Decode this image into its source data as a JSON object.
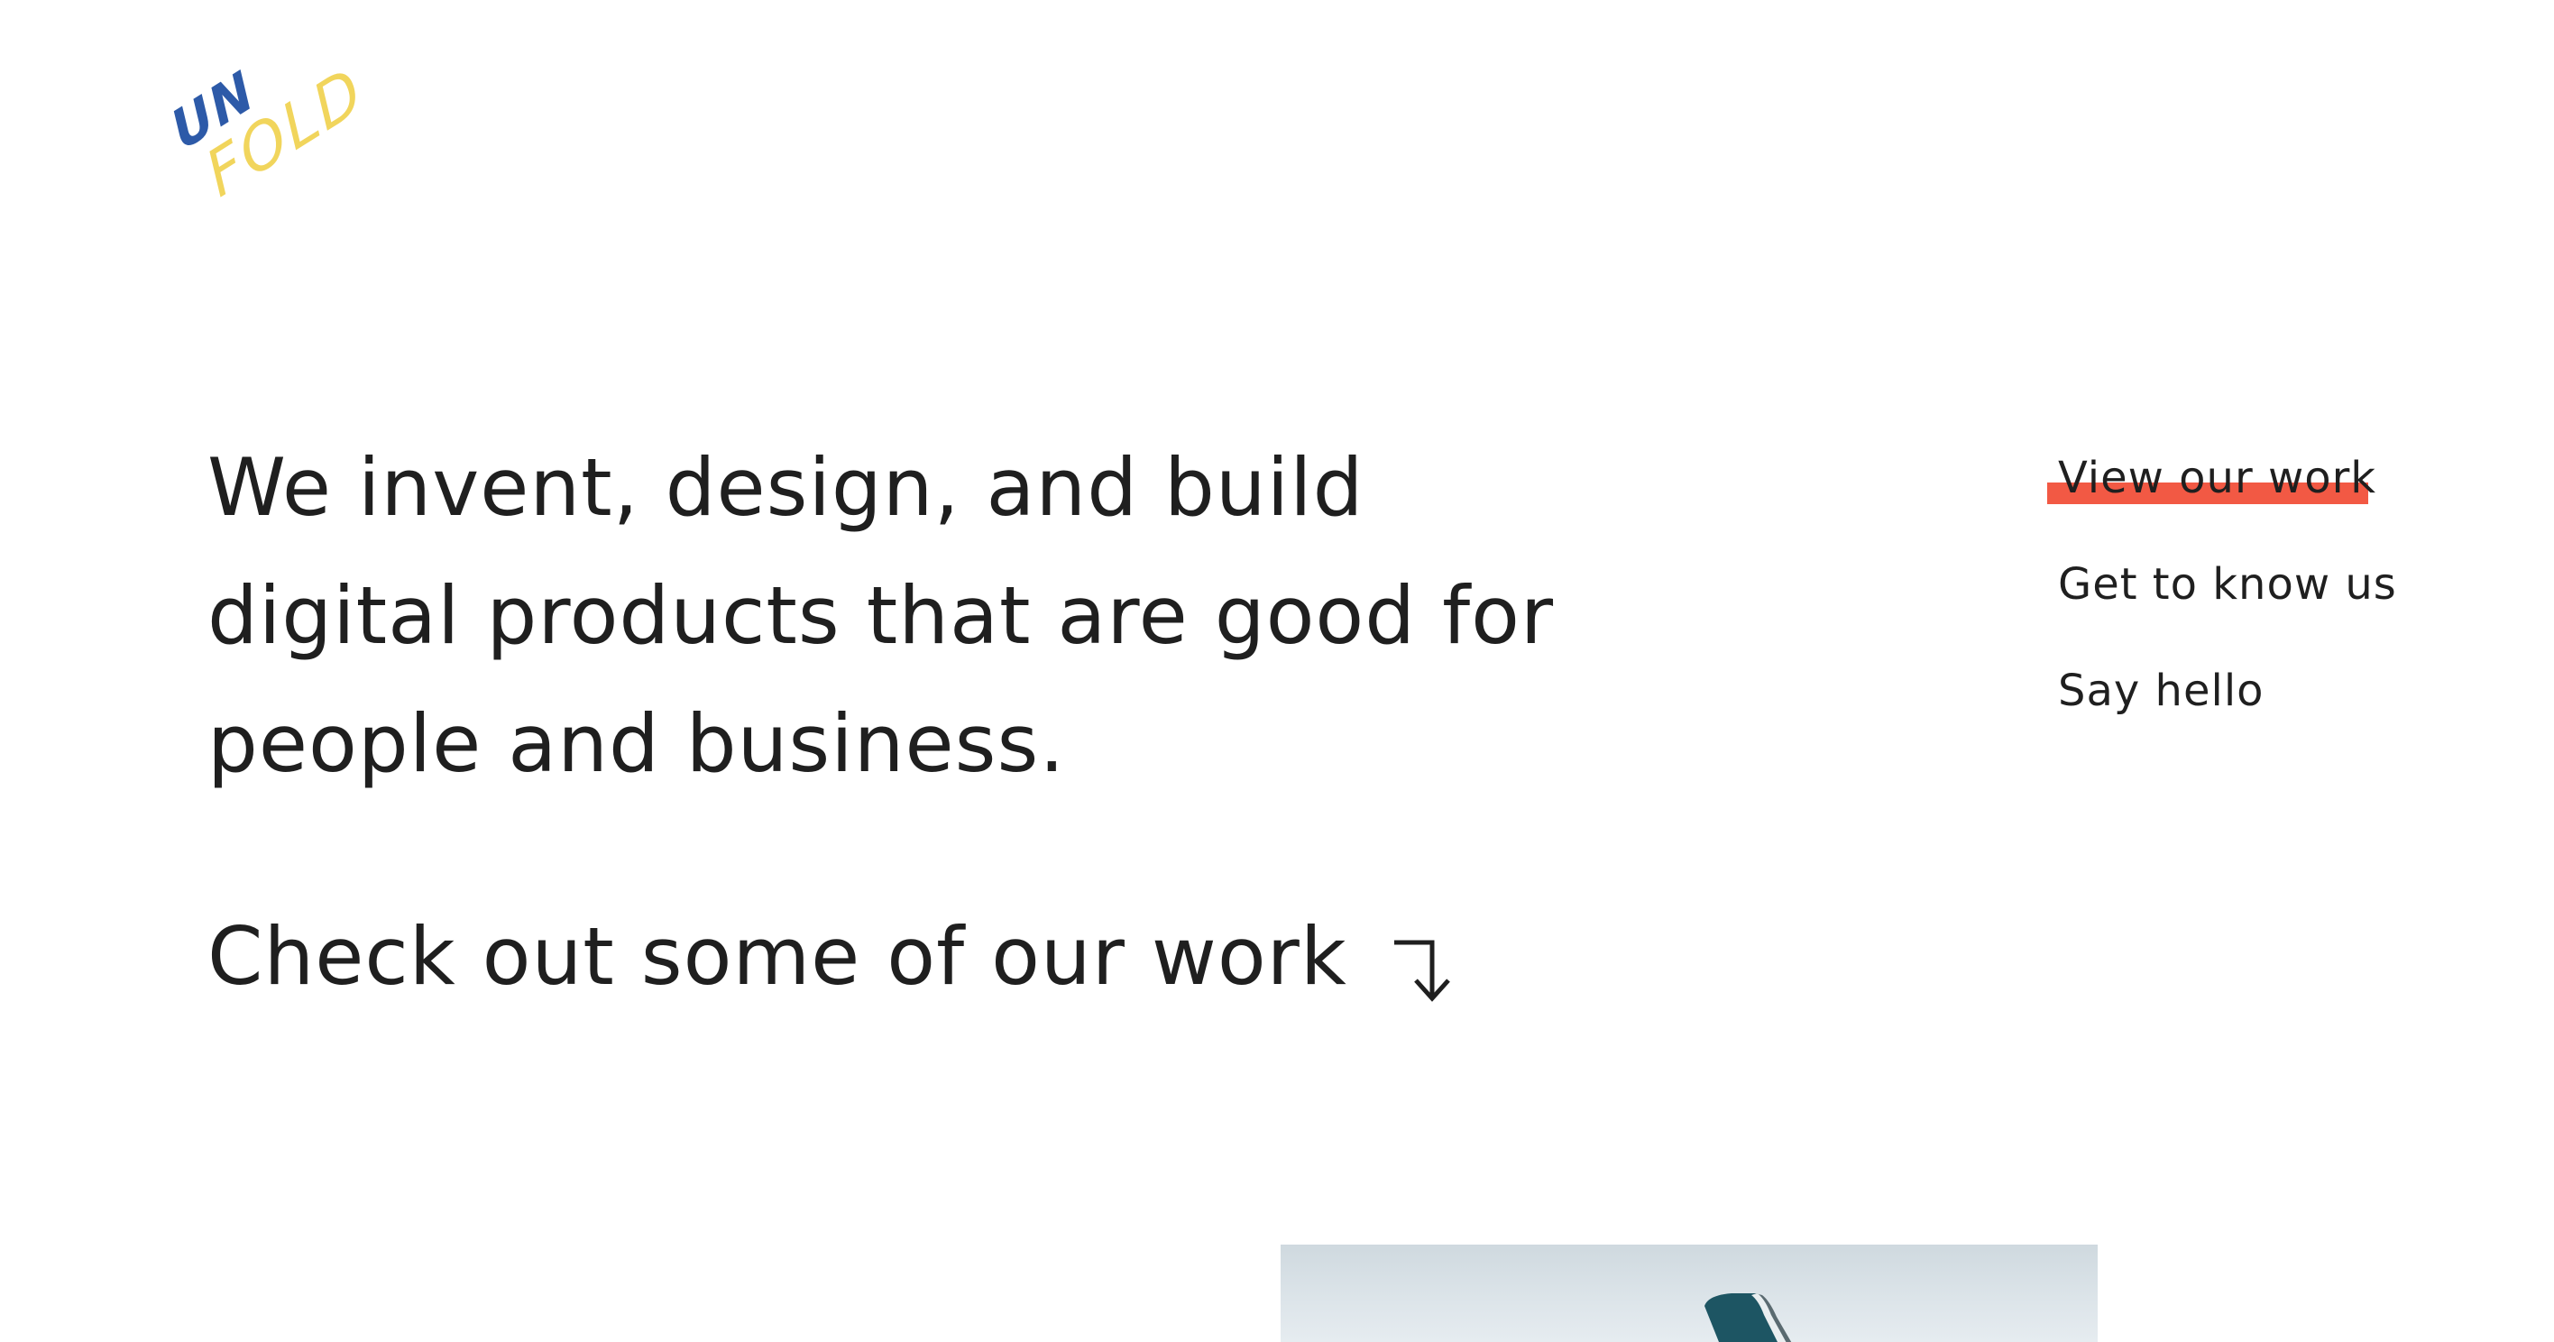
{
  "brand": {
    "logo_top": "UN",
    "logo_bottom": "FOLD",
    "colors": {
      "primary_blue": "#2d5aa8",
      "accent_yellow": "#f1d55c",
      "highlight_red": "#f25944",
      "text": "#1f1f1f"
    }
  },
  "hero": {
    "line1": "We invent, design, and build",
    "line2": "digital products that are good for",
    "line3": "people and business."
  },
  "cta": {
    "label": "Check out some of our work",
    "icon": "arrow-down-right-icon"
  },
  "nav": {
    "items": [
      {
        "label": "View our work",
        "active": true
      },
      {
        "label": "Get to know us",
        "active": false
      },
      {
        "label": "Say hello",
        "active": false
      }
    ]
  },
  "teaser": {
    "icon": "airplane-tail-image"
  }
}
